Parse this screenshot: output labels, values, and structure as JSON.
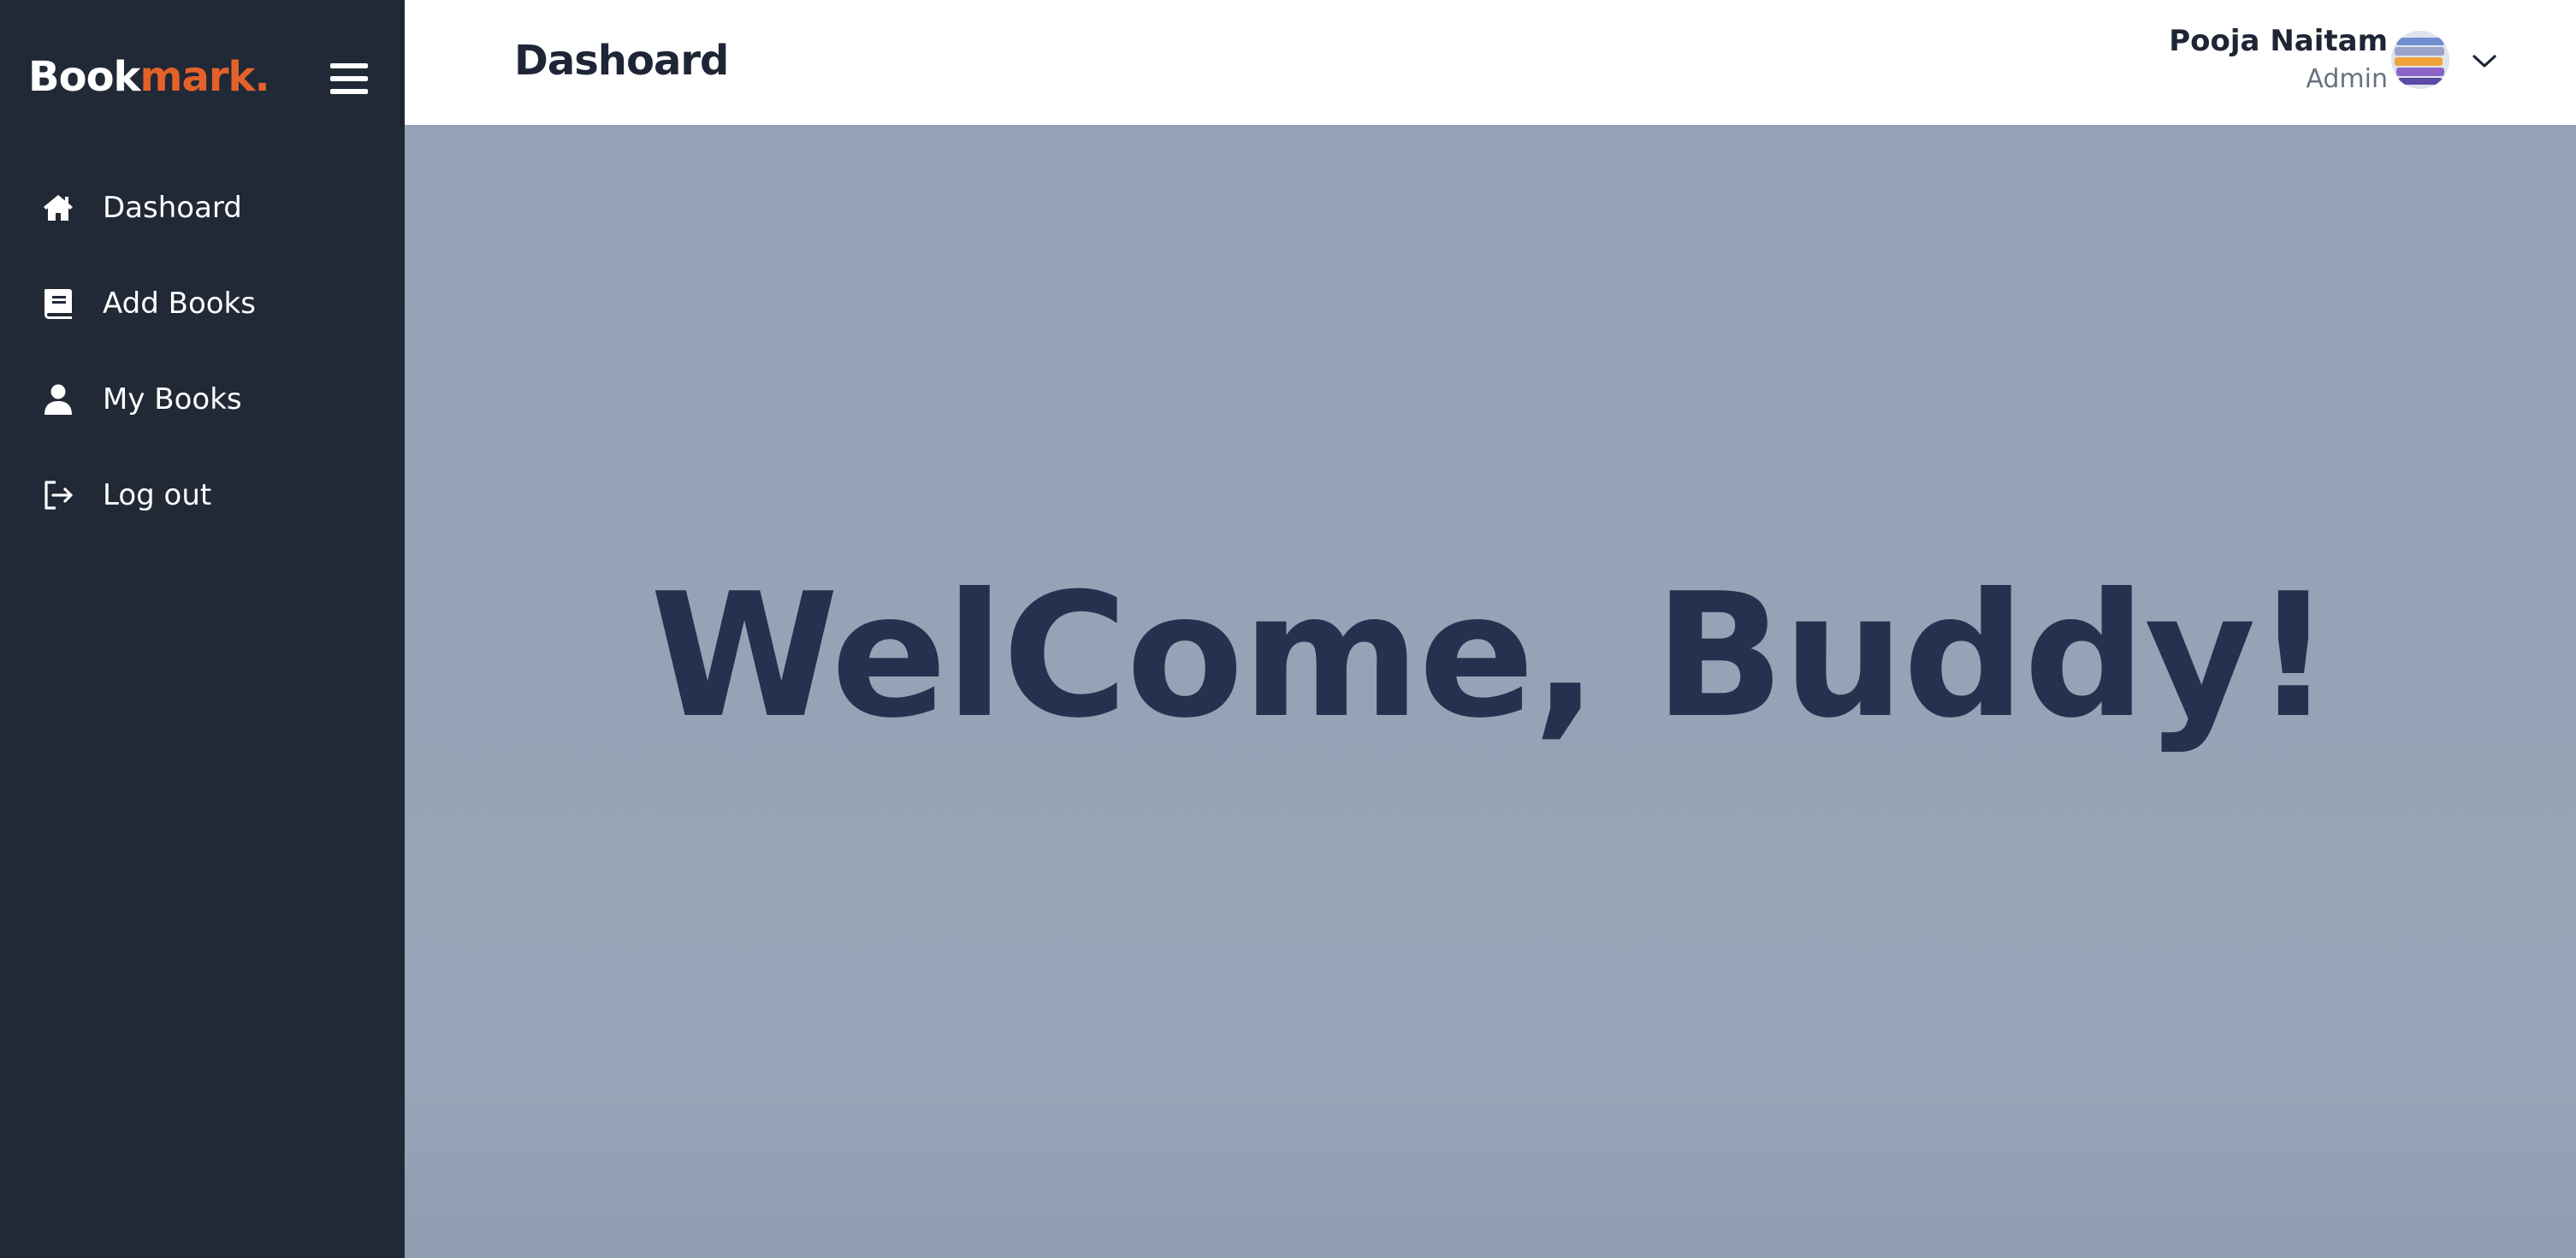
{
  "brand": {
    "part1": "Book",
    "part2": "mark."
  },
  "sidebar": {
    "items": [
      {
        "label": "Dashoard",
        "icon": "home-icon"
      },
      {
        "label": "Add Books",
        "icon": "book-icon"
      },
      {
        "label": "My Books",
        "icon": "user-icon"
      },
      {
        "label": "Log out",
        "icon": "logout-icon"
      }
    ]
  },
  "header": {
    "title": "Dashoard",
    "user": {
      "name": "Pooja Naitam",
      "role": "Admin"
    }
  },
  "main": {
    "welcome": "WelCome, Buddy!"
  },
  "colors": {
    "sidebar_bg": "#212836",
    "brand_accent": "#e3622a",
    "content_bg": "#95a2b5",
    "welcome_text": "#24324f"
  }
}
